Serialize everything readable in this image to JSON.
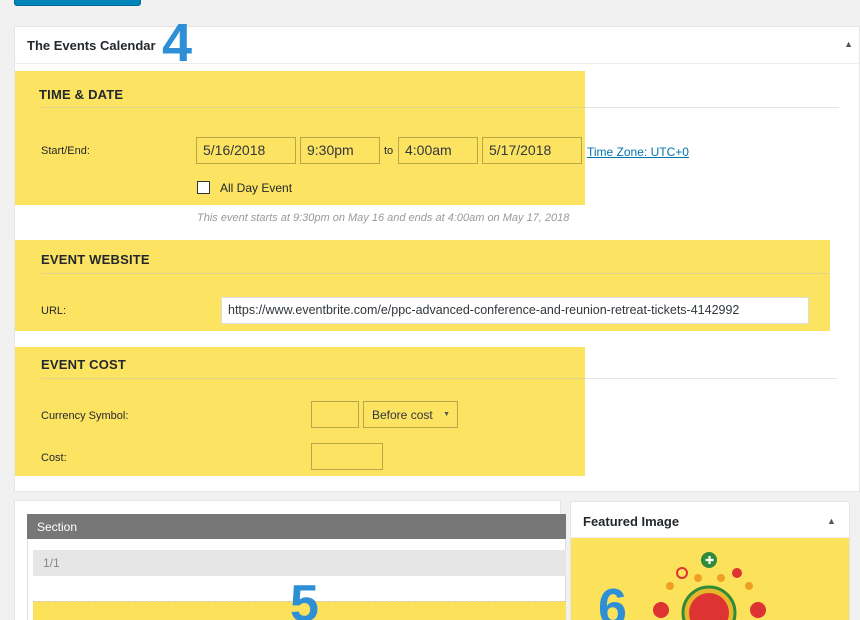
{
  "metabox": {
    "title": "The Events Calendar",
    "step": "4"
  },
  "time_date": {
    "title": "TIME & DATE",
    "start_end_label": "Start/End:",
    "start_date": "5/16/2018",
    "start_time": "9:30pm",
    "to": "to",
    "end_time": "4:00am",
    "end_date": "5/17/2018",
    "timezone": "Time Zone: UTC+0",
    "all_day_label": "All Day Event",
    "all_day_checked": false,
    "helptext": "This event starts at 9:30pm on May 16 and ends at 4:00am on May 17, 2018"
  },
  "website": {
    "title": "EVENT WEBSITE",
    "url_label": "URL:",
    "url_value": "https://www.eventbrite.com/e/ppc-advanced-conference-and-reunion-retreat-tickets-4142992"
  },
  "cost": {
    "title": "EVENT COST",
    "currency_label": "Currency Symbol:",
    "currency_value": "",
    "position_selected": "Before cost",
    "cost_label": "Cost:",
    "cost_value": ""
  },
  "section_panel": {
    "header": "Section",
    "row": "1/1",
    "step": "5"
  },
  "featured": {
    "title": "Featured Image",
    "step": "6"
  },
  "colors": {
    "highlight": "#fce15a",
    "step_number": "#2f8fd6",
    "link": "#0073aa"
  }
}
